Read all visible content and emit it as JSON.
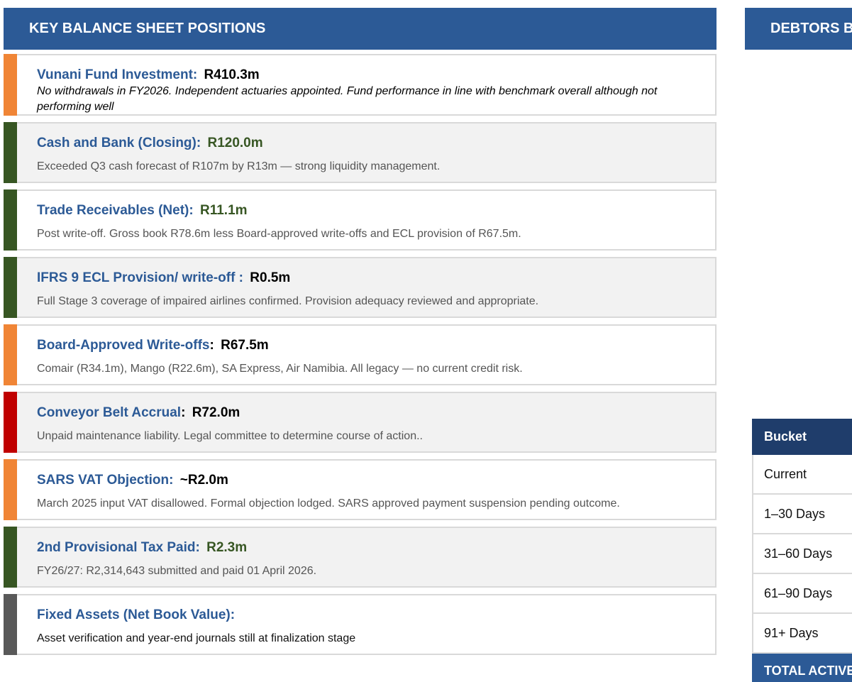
{
  "header": {
    "title": "KEY BALANCE SHEET POSITIONS"
  },
  "side_panel": {
    "title": "DEBTORS B"
  },
  "colors": {
    "header_blue": "#2c5a96",
    "orange": "#f08536",
    "green": "#375623",
    "red": "#c00000",
    "grey": "#595959"
  },
  "cards": [
    {
      "label": "Vunani Fund Investment:",
      "value": "R410.3m",
      "description": "No withdrawals in FY2026. Independent actuaries appointed. Fund performance in line with benchmark overall although not performing well"
    },
    {
      "label": "Cash and Bank (Closing):",
      "value": "R120.0m",
      "description": "Exceeded Q3 cash forecast of R107m by R13m — strong liquidity management."
    },
    {
      "label": "Trade Receivables (Net):",
      "value": "R11.1m",
      "description": "Post write-off. Gross book R78.6m less Board-approved write-offs and ECL provision of R67.5m."
    },
    {
      "label": "IFRS 9 ECL Provision/ write-off :",
      "value": "R0.5m",
      "description": "Full Stage 3 coverage of impaired airlines confirmed. Provision adequacy reviewed and appropriate."
    },
    {
      "label": "Board-Approved Write-offs",
      "colon": ":",
      "value": "R67.5m",
      "description": "Comair (R34.1m), Mango (R22.6m), SA Express, Air Namibia. All legacy — no current credit risk."
    },
    {
      "label": "Conveyor Belt Accrual",
      "colon": ":",
      "value": "R72.0m",
      "description": "Unpaid maintenance liability. Legal committee to determine course of action.."
    },
    {
      "label": "SARS VAT Objection:",
      "value": "~R2.0m",
      "description": "March 2025 input VAT disallowed. Formal objection lodged. SARS approved payment suspension pending outcome."
    },
    {
      "label": "2nd Provisional Tax Paid:",
      "value": "R2.3m",
      "description": "FY26/27: R2,314,643 submitted and paid 01 April 2026."
    },
    {
      "label": "Fixed Assets (Net Book Value):",
      "value": "",
      "description": "Asset verification and year-end journals still at finalization stage"
    }
  ],
  "bucket_table": {
    "header": "Bucket",
    "rows": [
      "Current",
      "1–30 Days",
      "31–60 Days",
      "61–90 Days",
      "91+ Days"
    ],
    "total": "TOTAL ACTIVE"
  }
}
